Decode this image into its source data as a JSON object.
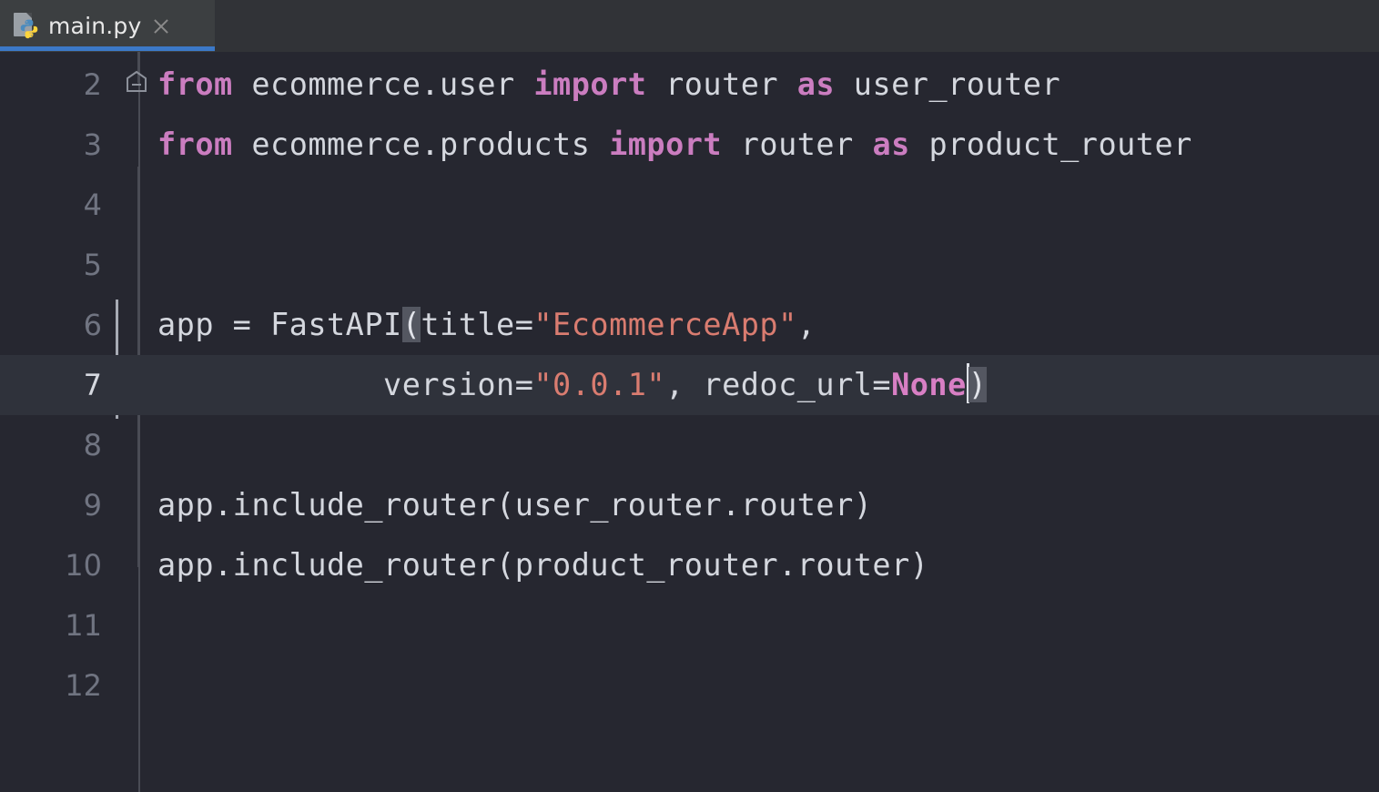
{
  "window": {
    "background_color": "#262730",
    "tabbar_color": "#313337"
  },
  "tabbar": {
    "tabs": [
      {
        "label": "main.py",
        "icon": "python-file-icon",
        "close_icon": "close-icon",
        "active": true,
        "underline_color": "#3C79C8"
      }
    ]
  },
  "editor": {
    "language": "Python",
    "caret_line": 7,
    "caret_column": 37,
    "current_line_highlight_color": "#2F323B",
    "matching_brace_highlight_color": "#545761",
    "colors": {
      "keyword": "#CB7DC0",
      "string": "#D97C70",
      "constant": "#D87FC4",
      "identifier": "#D4D7DE",
      "line_number": "#707481",
      "line_number_active": "#D6D9E0"
    },
    "gutter": {
      "fold_marker_line": 3,
      "fold_marker_state": "expanded"
    },
    "lines": [
      {
        "number": "2",
        "tokens": [
          {
            "t": "from",
            "c": "kw"
          },
          {
            "t": " ecommerce.user ",
            "c": "plain"
          },
          {
            "t": "import",
            "c": "kw"
          },
          {
            "t": " router ",
            "c": "plain"
          },
          {
            "t": "as",
            "c": "kw"
          },
          {
            "t": " user_router",
            "c": "plain"
          }
        ]
      },
      {
        "number": "3",
        "tokens": [
          {
            "t": "from",
            "c": "kw"
          },
          {
            "t": " ecommerce.products ",
            "c": "plain"
          },
          {
            "t": "import",
            "c": "kw"
          },
          {
            "t": " router ",
            "c": "plain"
          },
          {
            "t": "as",
            "c": "kw"
          },
          {
            "t": " product_router",
            "c": "plain"
          }
        ]
      },
      {
        "number": "4",
        "tokens": []
      },
      {
        "number": "5",
        "tokens": []
      },
      {
        "number": "6",
        "tokens": [
          {
            "t": "app = FastAPI",
            "c": "plain"
          },
          {
            "t": "(",
            "c": "brace-hl"
          },
          {
            "t": "title=",
            "c": "plain"
          },
          {
            "t": "\"EcommerceApp\"",
            "c": "str"
          },
          {
            "t": ",",
            "c": "plain"
          }
        ]
      },
      {
        "number": "7",
        "current": true,
        "tokens": [
          {
            "t": "            version=",
            "c": "plain"
          },
          {
            "t": "\"0.0.1\"",
            "c": "str"
          },
          {
            "t": ", redoc_url=",
            "c": "plain"
          },
          {
            "t": "None",
            "c": "none"
          },
          {
            "t": "|CARET|",
            "c": "caret"
          },
          {
            "t": ")",
            "c": "brace-hl"
          }
        ]
      },
      {
        "number": "8",
        "tokens": []
      },
      {
        "number": "9",
        "tokens": [
          {
            "t": "app.include_router(user_router.router)",
            "c": "plain"
          }
        ]
      },
      {
        "number": "10",
        "tokens": [
          {
            "t": "app.include_router(product_router.router)",
            "c": "plain"
          }
        ]
      },
      {
        "number": "11",
        "tokens": []
      },
      {
        "number": "12",
        "tokens": []
      }
    ]
  }
}
